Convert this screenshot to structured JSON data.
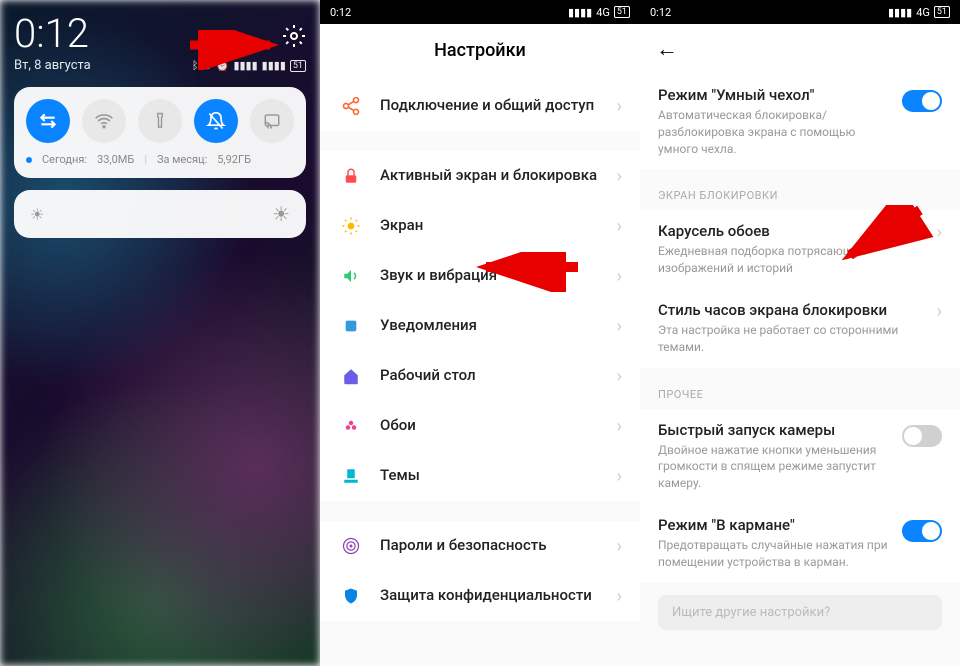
{
  "phone1": {
    "time": "0:12",
    "date": "Вт, 8 августа",
    "status_icons": [
      "bluetooth",
      "dnd",
      "alarm",
      "signal-sim1",
      "signal-sim2",
      "battery-51"
    ],
    "toggles": [
      {
        "name": "data-toggle",
        "icon": "⇅",
        "on": true
      },
      {
        "name": "wifi-toggle",
        "icon": "wifi",
        "on": false
      },
      {
        "name": "flashlight-toggle",
        "icon": "flash",
        "on": false
      },
      {
        "name": "dnd-toggle",
        "icon": "bell-off",
        "on": true
      },
      {
        "name": "cast-toggle",
        "icon": "cast",
        "on": false
      }
    ],
    "usage_today_label": "Сегодня:",
    "usage_today_value": "33,0МБ",
    "usage_month_label": "За месяц:",
    "usage_month_value": "5,92ГБ"
  },
  "phone2": {
    "statusbar_time": "0:12",
    "statusbar_net": "4G",
    "statusbar_batt": "51",
    "title": "Настройки",
    "items": [
      {
        "label": "Подключение и общий доступ",
        "icon": "share",
        "color": "#ff6b35"
      },
      {
        "label": "Активный экран и блокировка",
        "icon": "lock",
        "color": "#ff4d4d"
      },
      {
        "label": "Экран",
        "icon": "sun",
        "color": "#ffb800"
      },
      {
        "label": "Звук и вибрация",
        "icon": "volume",
        "color": "#2ecc71"
      },
      {
        "label": "Уведомления",
        "icon": "notif",
        "color": "#3498db"
      },
      {
        "label": "Рабочий стол",
        "icon": "home",
        "color": "#6c5ce7"
      },
      {
        "label": "Обои",
        "icon": "flower",
        "color": "#e84393"
      },
      {
        "label": "Темы",
        "icon": "brush",
        "color": "#00b8d4"
      },
      {
        "label": "Пароли и безопасность",
        "icon": "fingerprint",
        "color": "#8e44ad"
      },
      {
        "label": "Защита конфиденциальности",
        "icon": "shield",
        "color": "#0984e3"
      }
    ]
  },
  "phone3": {
    "statusbar_time": "0:12",
    "statusbar_net": "4G",
    "statusbar_batt": "51",
    "smart_cover": {
      "title": "Режим \"Умный чехол\"",
      "sub": "Автоматическая блокировка/разблокировка экрана с помощью умного чехла.",
      "on": true
    },
    "section_lock": "ЭКРАН БЛОКИРОВКИ",
    "carousel": {
      "title": "Карусель обоев",
      "sub": "Ежедневная подборка потрясающих изображений и историй"
    },
    "clock_style": {
      "title": "Стиль часов экрана блокировки",
      "sub": "Эта настройка не работает со сторонними темами."
    },
    "section_other": "ПРОЧЕЕ",
    "quick_camera": {
      "title": "Быстрый запуск камеры",
      "sub": "Двойное нажатие кнопки уменьшения громкости в спящем режиме запустит камеру.",
      "on": false
    },
    "pocket": {
      "title": "Режим \"В кармане\"",
      "sub": "Предотвращать случайные нажатия при помещении устройства в карман.",
      "on": true
    },
    "search_placeholder": "Ищите другие настройки?"
  }
}
